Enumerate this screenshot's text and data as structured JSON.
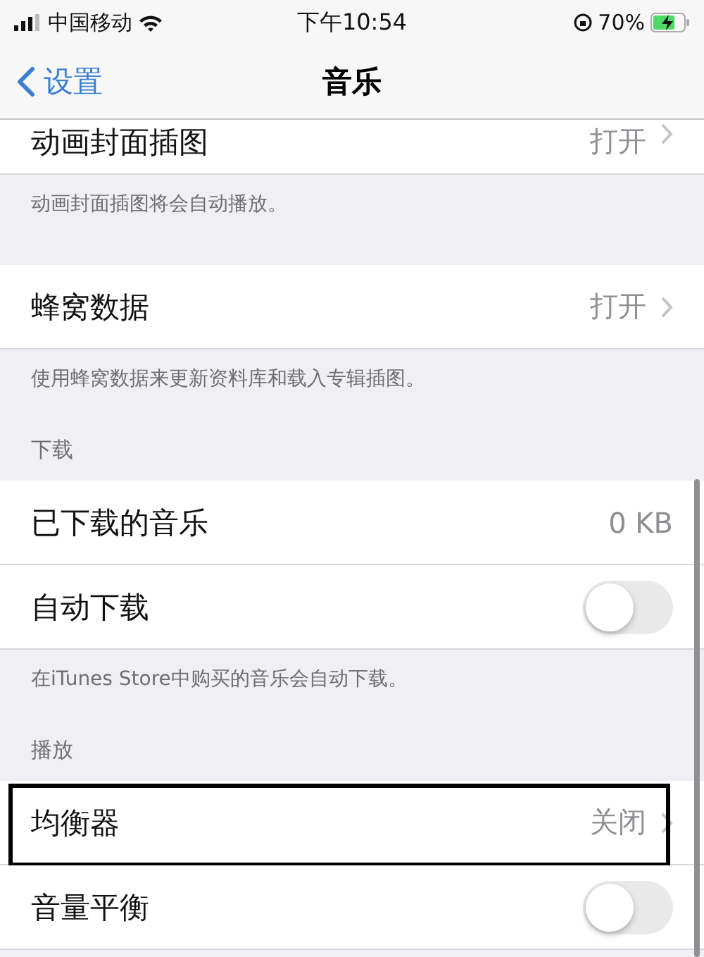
{
  "status_bar": {
    "carrier": "中国移动",
    "time": "下午10:54",
    "battery": "70%"
  },
  "nav": {
    "back": "设置",
    "title": "音乐"
  },
  "sections": [
    {
      "rows": [
        {
          "kind": "value",
          "label": "动画封面插图",
          "value": "打开",
          "highlighted": false
        }
      ],
      "footer": "动画封面插图将会自动播放。"
    },
    {
      "rows": [
        {
          "kind": "value",
          "label": "蜂窝数据",
          "value": "打开",
          "highlighted": false
        }
      ],
      "footer": "使用蜂窝数据来更新资料库和载入专辑插图。"
    },
    {
      "header": "下载",
      "rows": [
        {
          "kind": "text",
          "label": "已下载的音乐",
          "value": "0 KB",
          "highlighted": false
        },
        {
          "kind": "toggle",
          "label": "自动下载",
          "on": false,
          "highlighted": false
        }
      ],
      "footer": "在iTunes Store中购买的音乐会自动下载。"
    },
    {
      "header": "播放",
      "rows": [
        {
          "kind": "value",
          "label": "均衡器",
          "value": "关闭",
          "highlighted": true
        },
        {
          "kind": "toggle",
          "label": "音量平衡",
          "on": false,
          "highlighted": false
        }
      ]
    }
  ]
}
